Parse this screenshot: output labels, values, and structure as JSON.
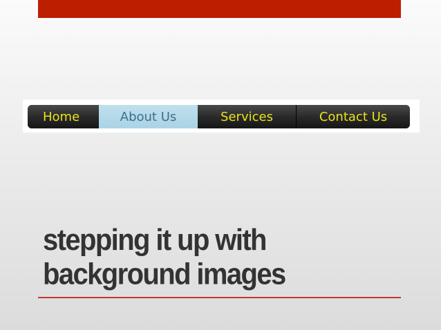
{
  "slide": {
    "nav": {
      "items": [
        {
          "label": "Home",
          "active": false
        },
        {
          "label": "About Us",
          "active": true
        },
        {
          "label": "Services",
          "active": false
        },
        {
          "label": "Contact Us",
          "active": false
        }
      ]
    },
    "title": {
      "line1": "stepping it up with",
      "line2": "background images"
    }
  },
  "colors": {
    "accent_red": "#bd1e00",
    "nav_text": "#e8e41c",
    "nav_active_bg": "#a9d3e6",
    "nav_active_text": "#3d6f88",
    "title_text": "#333333"
  }
}
